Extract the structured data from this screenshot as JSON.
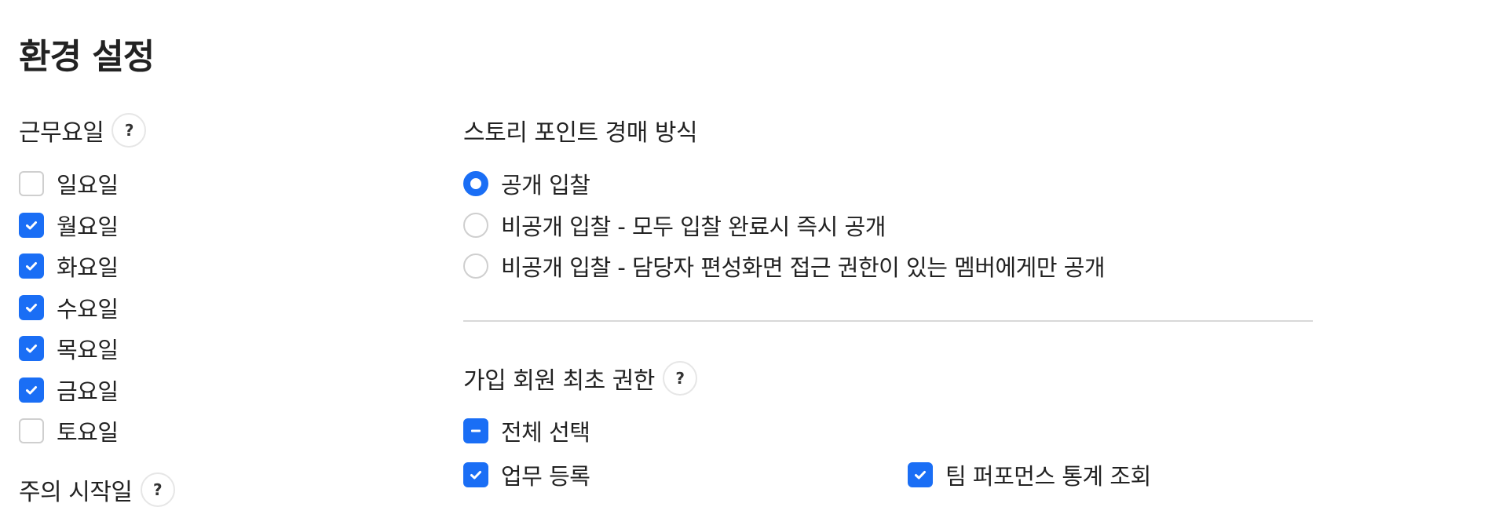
{
  "page": {
    "title": "환경 설정"
  },
  "workdays": {
    "title": "근무요일",
    "help": "?",
    "items": [
      {
        "label": "일요일",
        "checked": false
      },
      {
        "label": "월요일",
        "checked": true
      },
      {
        "label": "화요일",
        "checked": true
      },
      {
        "label": "수요일",
        "checked": true
      },
      {
        "label": "목요일",
        "checked": true
      },
      {
        "label": "금요일",
        "checked": true
      },
      {
        "label": "토요일",
        "checked": false
      }
    ]
  },
  "week_start": {
    "title": "주의 시작일",
    "help": "?"
  },
  "auction": {
    "title": "스토리 포인트 경매 방식",
    "selected": 0,
    "options": [
      "공개 입찰",
      "비공개 입찰 - 모두 입찰 완료시 즉시 공개",
      "비공개 입찰 - 담당자 편성화면 접근 권한이 있는 멤버에게만 공개"
    ]
  },
  "permissions": {
    "title": "가입 회원 최초 권한",
    "help": "?",
    "select_all": {
      "label": "전체 선택",
      "state": "indeterminate"
    },
    "items": [
      {
        "label": "업무 등록",
        "checked": true
      },
      {
        "label": "팀 퍼포먼스 통계 조회",
        "checked": true
      }
    ]
  },
  "colors": {
    "accent": "#1a6ef5",
    "border": "#cfcfcf",
    "divider": "#d8d8d8",
    "text": "#222222"
  },
  "icons": {
    "checked": "check-icon",
    "indeterminate": "minus-icon",
    "help": "question-mark-icon"
  }
}
